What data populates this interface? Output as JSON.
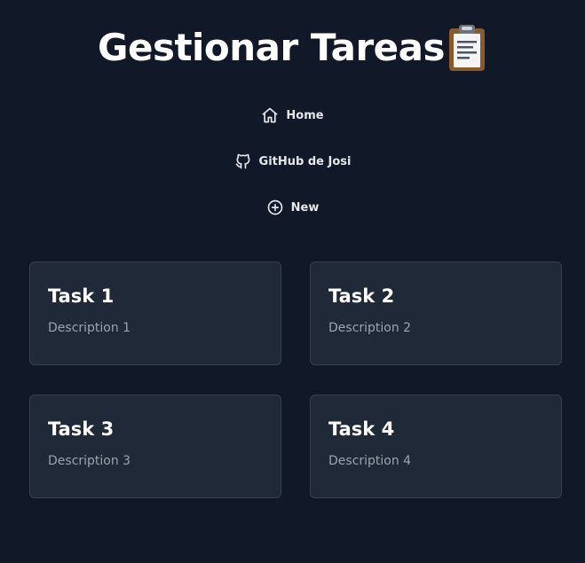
{
  "header": {
    "title": "Gestionar Tareas"
  },
  "nav": {
    "items": [
      {
        "label": "Home",
        "icon": "home-icon"
      },
      {
        "label": "GitHub de Josi",
        "icon": "github-icon"
      },
      {
        "label": "New",
        "icon": "plus-circle-icon"
      }
    ]
  },
  "tasks": [
    {
      "title": "Task 1",
      "description": "Description 1"
    },
    {
      "title": "Task 2",
      "description": "Description 2"
    },
    {
      "title": "Task 3",
      "description": "Description 3"
    },
    {
      "title": "Task 4",
      "description": "Description 4"
    }
  ],
  "colors": {
    "background": "#111827",
    "card": "#1f2937",
    "card_border": "#374151",
    "description": "#9ca3af",
    "text": "#ffffff"
  }
}
